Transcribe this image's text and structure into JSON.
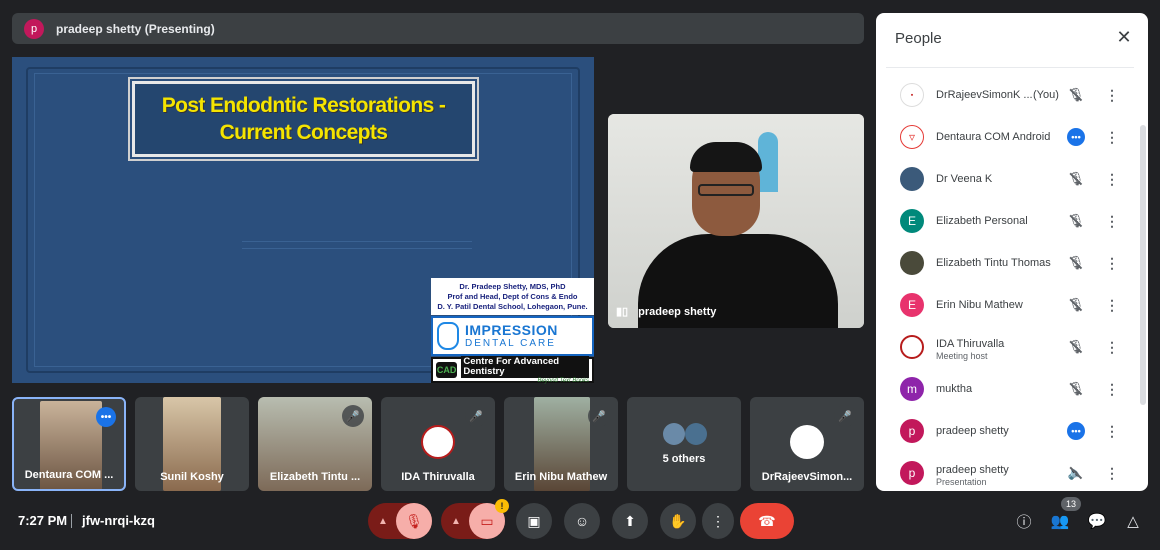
{
  "presenter_bar": {
    "avatar_letter": "p",
    "text": "pradeep shetty (Presenting)"
  },
  "slide": {
    "title_line1": "Post Endodntic Restorations -",
    "title_line2": "Current Concepts",
    "credit_line1": "Dr. Pradeep Shetty, MDS, PhD",
    "credit_line2": "Prof and Head, Dept of Cons & Endo",
    "credit_line3": "D. Y. Patil Dental School, Lohegaon, Pune.",
    "impression_title": "IMPRESSION",
    "impression_sub": "DENTAL CARE",
    "cad_logo": "CAD",
    "cad_title": "Centre For Advanced Dentistry",
    "cad_sub": "Beyond Text Books"
  },
  "main_video": {
    "name": "pradeep shetty"
  },
  "tiles": [
    {
      "label": "Dentaura COM ..."
    },
    {
      "label": "Sunil Koshy"
    },
    {
      "label": "Elizabeth Tintu ..."
    },
    {
      "label": "IDA Thiruvalla"
    },
    {
      "label": "Erin Nibu Mathew"
    },
    {
      "label": "5 others"
    },
    {
      "label": "DrRajeevSimon..."
    }
  ],
  "bottom_bar": {
    "time": "7:27 PM",
    "meeting_code": "jfw-nrqi-kzq",
    "people_count": "13",
    "warn": "!"
  },
  "panel": {
    "title": "People",
    "you_label": "(You)",
    "people": [
      {
        "name": "DrRajeevSimonK ...",
        "avatar": "",
        "avatar_color": "#ffffff"
      },
      {
        "name": "Dentaura COM Android",
        "avatar": "",
        "avatar_color": "#ffffff"
      },
      {
        "name": "Dr Veena K",
        "avatar": "",
        "avatar_color": "#3b5a7a"
      },
      {
        "name": "Elizabeth Personal",
        "avatar": "E",
        "avatar_color": "#00897b"
      },
      {
        "name": "Elizabeth Tintu Thomas",
        "avatar": "",
        "avatar_color": "#4a4a3a"
      },
      {
        "name": "Erin Nibu Mathew",
        "avatar": "E",
        "avatar_color": "#e8336d"
      },
      {
        "name": "IDA Thiruvalla",
        "sub": "Meeting host",
        "avatar": "",
        "avatar_color": "#ffffff"
      },
      {
        "name": "muktha",
        "avatar": "m",
        "avatar_color": "#8e24aa"
      },
      {
        "name": "pradeep shetty",
        "avatar": "p",
        "avatar_color": "#c2185b"
      },
      {
        "name": "pradeep shetty",
        "sub": "Presentation",
        "avatar": "p",
        "avatar_color": "#c2185b"
      }
    ]
  },
  "colors": {
    "background": "#202124",
    "accent_blue": "#1a73e8",
    "end_call": "#ea4335",
    "mic_off_bg": "#f6aea9"
  }
}
